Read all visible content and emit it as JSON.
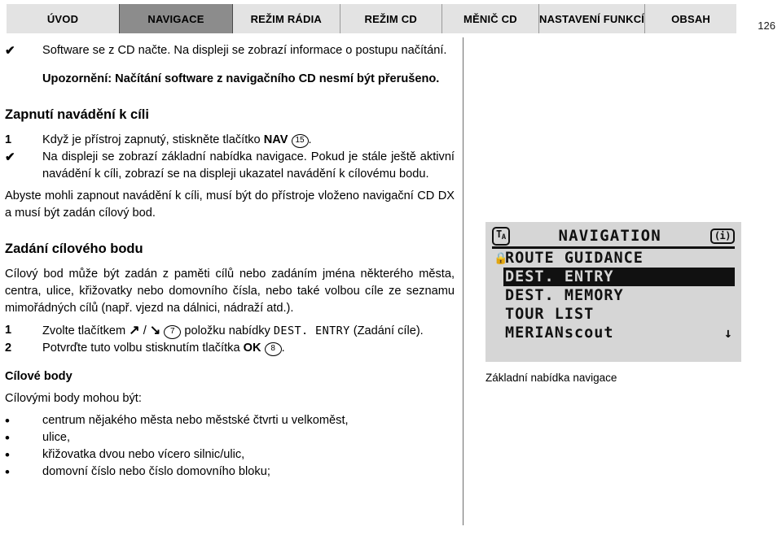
{
  "page": {
    "number": "126"
  },
  "tabs": [
    {
      "label": "ÚVOD",
      "active": false,
      "flex": 2.22
    },
    {
      "label": "NAVIGACE",
      "active": true,
      "flex": 2.22
    },
    {
      "label": "REŽIM RÁDIA",
      "active": false,
      "flex": 2.1
    },
    {
      "label": "REŽIM CD",
      "active": false,
      "flex": 2.0
    },
    {
      "label": "MĚNIČ CD",
      "active": false,
      "flex": 1.9
    },
    {
      "label": "NASTAVENÍ FUNKCÍ",
      "active": false,
      "flex": 1.75
    },
    {
      "label": "OBSAH",
      "active": false,
      "flex": 1.8
    }
  ],
  "content": {
    "check_symbol": "✔",
    "bullet_symbol": "•",
    "step1_marker": "1",
    "step2_marker": "2",
    "intro_check": "Software se z CD načte. Na displeji se zobrazí informace o postupu načítání.",
    "warning": "Upozornění: Načítání software z navigačního CD nesmí být přerušeno.",
    "heading_enable": "Zapnutí navádění k cíli",
    "enable_step1_pre": "Když je přístroj zapnutý, stiskněte tlačítko ",
    "enable_step1_bold": "NAV",
    "enable_step1_callout": "15",
    "enable_step1_post": ".",
    "enable_check": "Na displeji se zobrazí základní nabídka navigace. Pokud je stále ještě aktivní navádění k cíli, zobrazí se na displeji ukazatel navádění k cílovému bodu.",
    "enable_note": "Abyste mohli zapnout navádění k cíli, musí být do přístroje vloženo navigační CD DX a musí být zadán cílový bod.",
    "heading_entry": "Zadání cílového bodu",
    "entry_para": "Cílový bod může být zadán z paměti cílů nebo zadáním jména některého města, centra, ulice, křižovatky nebo domovního čísla, nebo také volbou cíle ze seznamu mimořádných cílů (např. vjezd na dálnici, nádraží atd.).",
    "entry_step1_pre": "Zvolte tlačítkem ",
    "entry_step1_arrow_up": "↗",
    "entry_step1_arrow_sep": " / ",
    "entry_step1_arrow_down": "↘",
    "entry_step1_callout": "7",
    "entry_step1_mid": " položku nabídky ",
    "entry_step1_code": "DEST. ENTRY",
    "entry_step1_post": " (Zadání cíle).",
    "entry_step2_pre": "Potvrďte tuto volbu stisknutím tlačítka ",
    "entry_step2_bold": "OK",
    "entry_step2_callout": "8",
    "entry_step2_post": ".",
    "subheading_targets": "Cílové body",
    "targets_intro": "Cílovými body mohou být:",
    "targets": [
      "centrum nějakého města nebo městské čtvrti u velkoměst,",
      "ulice,",
      "křižovatka dvou nebo vícero silnic/ulic,",
      "domovní číslo nebo číslo domovního bloku;"
    ]
  },
  "lcd": {
    "badge_left": "T",
    "badge_left_sub": "A",
    "title": "NAVIGATION",
    "badge_right": "(i)",
    "lock_symbol": "🔒",
    "down_arrow": "↓",
    "items": [
      {
        "label": "ROUTE GUIDANCE",
        "locked": true,
        "selected": false,
        "arrow": false
      },
      {
        "label": "DEST. ENTRY",
        "locked": false,
        "selected": true,
        "arrow": false
      },
      {
        "label": "DEST. MEMORY",
        "locked": false,
        "selected": false,
        "arrow": false
      },
      {
        "label": "TOUR LIST",
        "locked": false,
        "selected": false,
        "arrow": false
      },
      {
        "label": "MERIANscout",
        "locked": false,
        "selected": false,
        "arrow": true
      }
    ],
    "caption": "Základní nabídka navigace"
  },
  "colors": {
    "tab_inactive_bg": "#e3e3e3",
    "tab_active_bg": "#8c8c8c",
    "lcd_bg": "#d6d6d6",
    "lcd_fg": "#111111",
    "divider": "#6d6d6d"
  }
}
